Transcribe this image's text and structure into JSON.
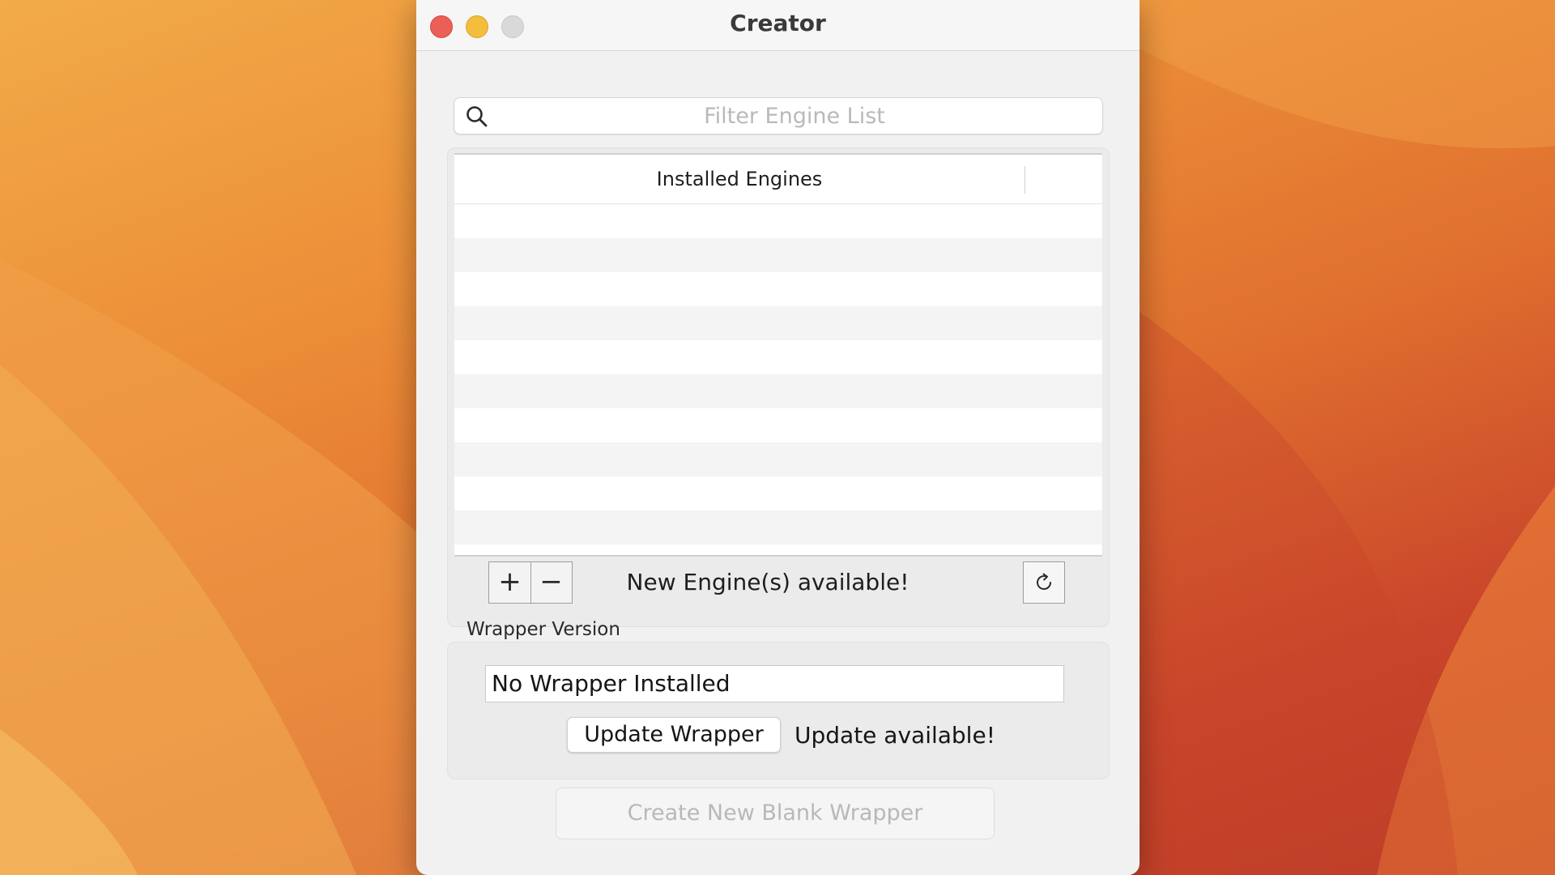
{
  "window": {
    "title": "Creator",
    "controls": {
      "close_color": "#ec5f57",
      "minimize_color": "#f4bd3c",
      "zoom_color": "#d9d9d9"
    }
  },
  "search": {
    "placeholder": "Filter Engine List",
    "value": "",
    "icon": "magnifying-glass"
  },
  "engine_table": {
    "column_header": "Installed Engines",
    "rows": []
  },
  "engine_toolbar": {
    "add_label": "+",
    "remove_label": "−",
    "status": "New Engine(s) available!",
    "refresh_icon": "refresh-arrow"
  },
  "wrapper": {
    "section_label": "Wrapper Version",
    "version_value": "No Wrapper Installed",
    "update_button": "Update Wrapper",
    "update_status": "Update available!"
  },
  "footer": {
    "create_button": "Create New Blank Wrapper",
    "create_enabled": false
  },
  "colors": {
    "wallpaper_accent": "#ec8e38",
    "disabled_text": "#b8b8b8"
  }
}
